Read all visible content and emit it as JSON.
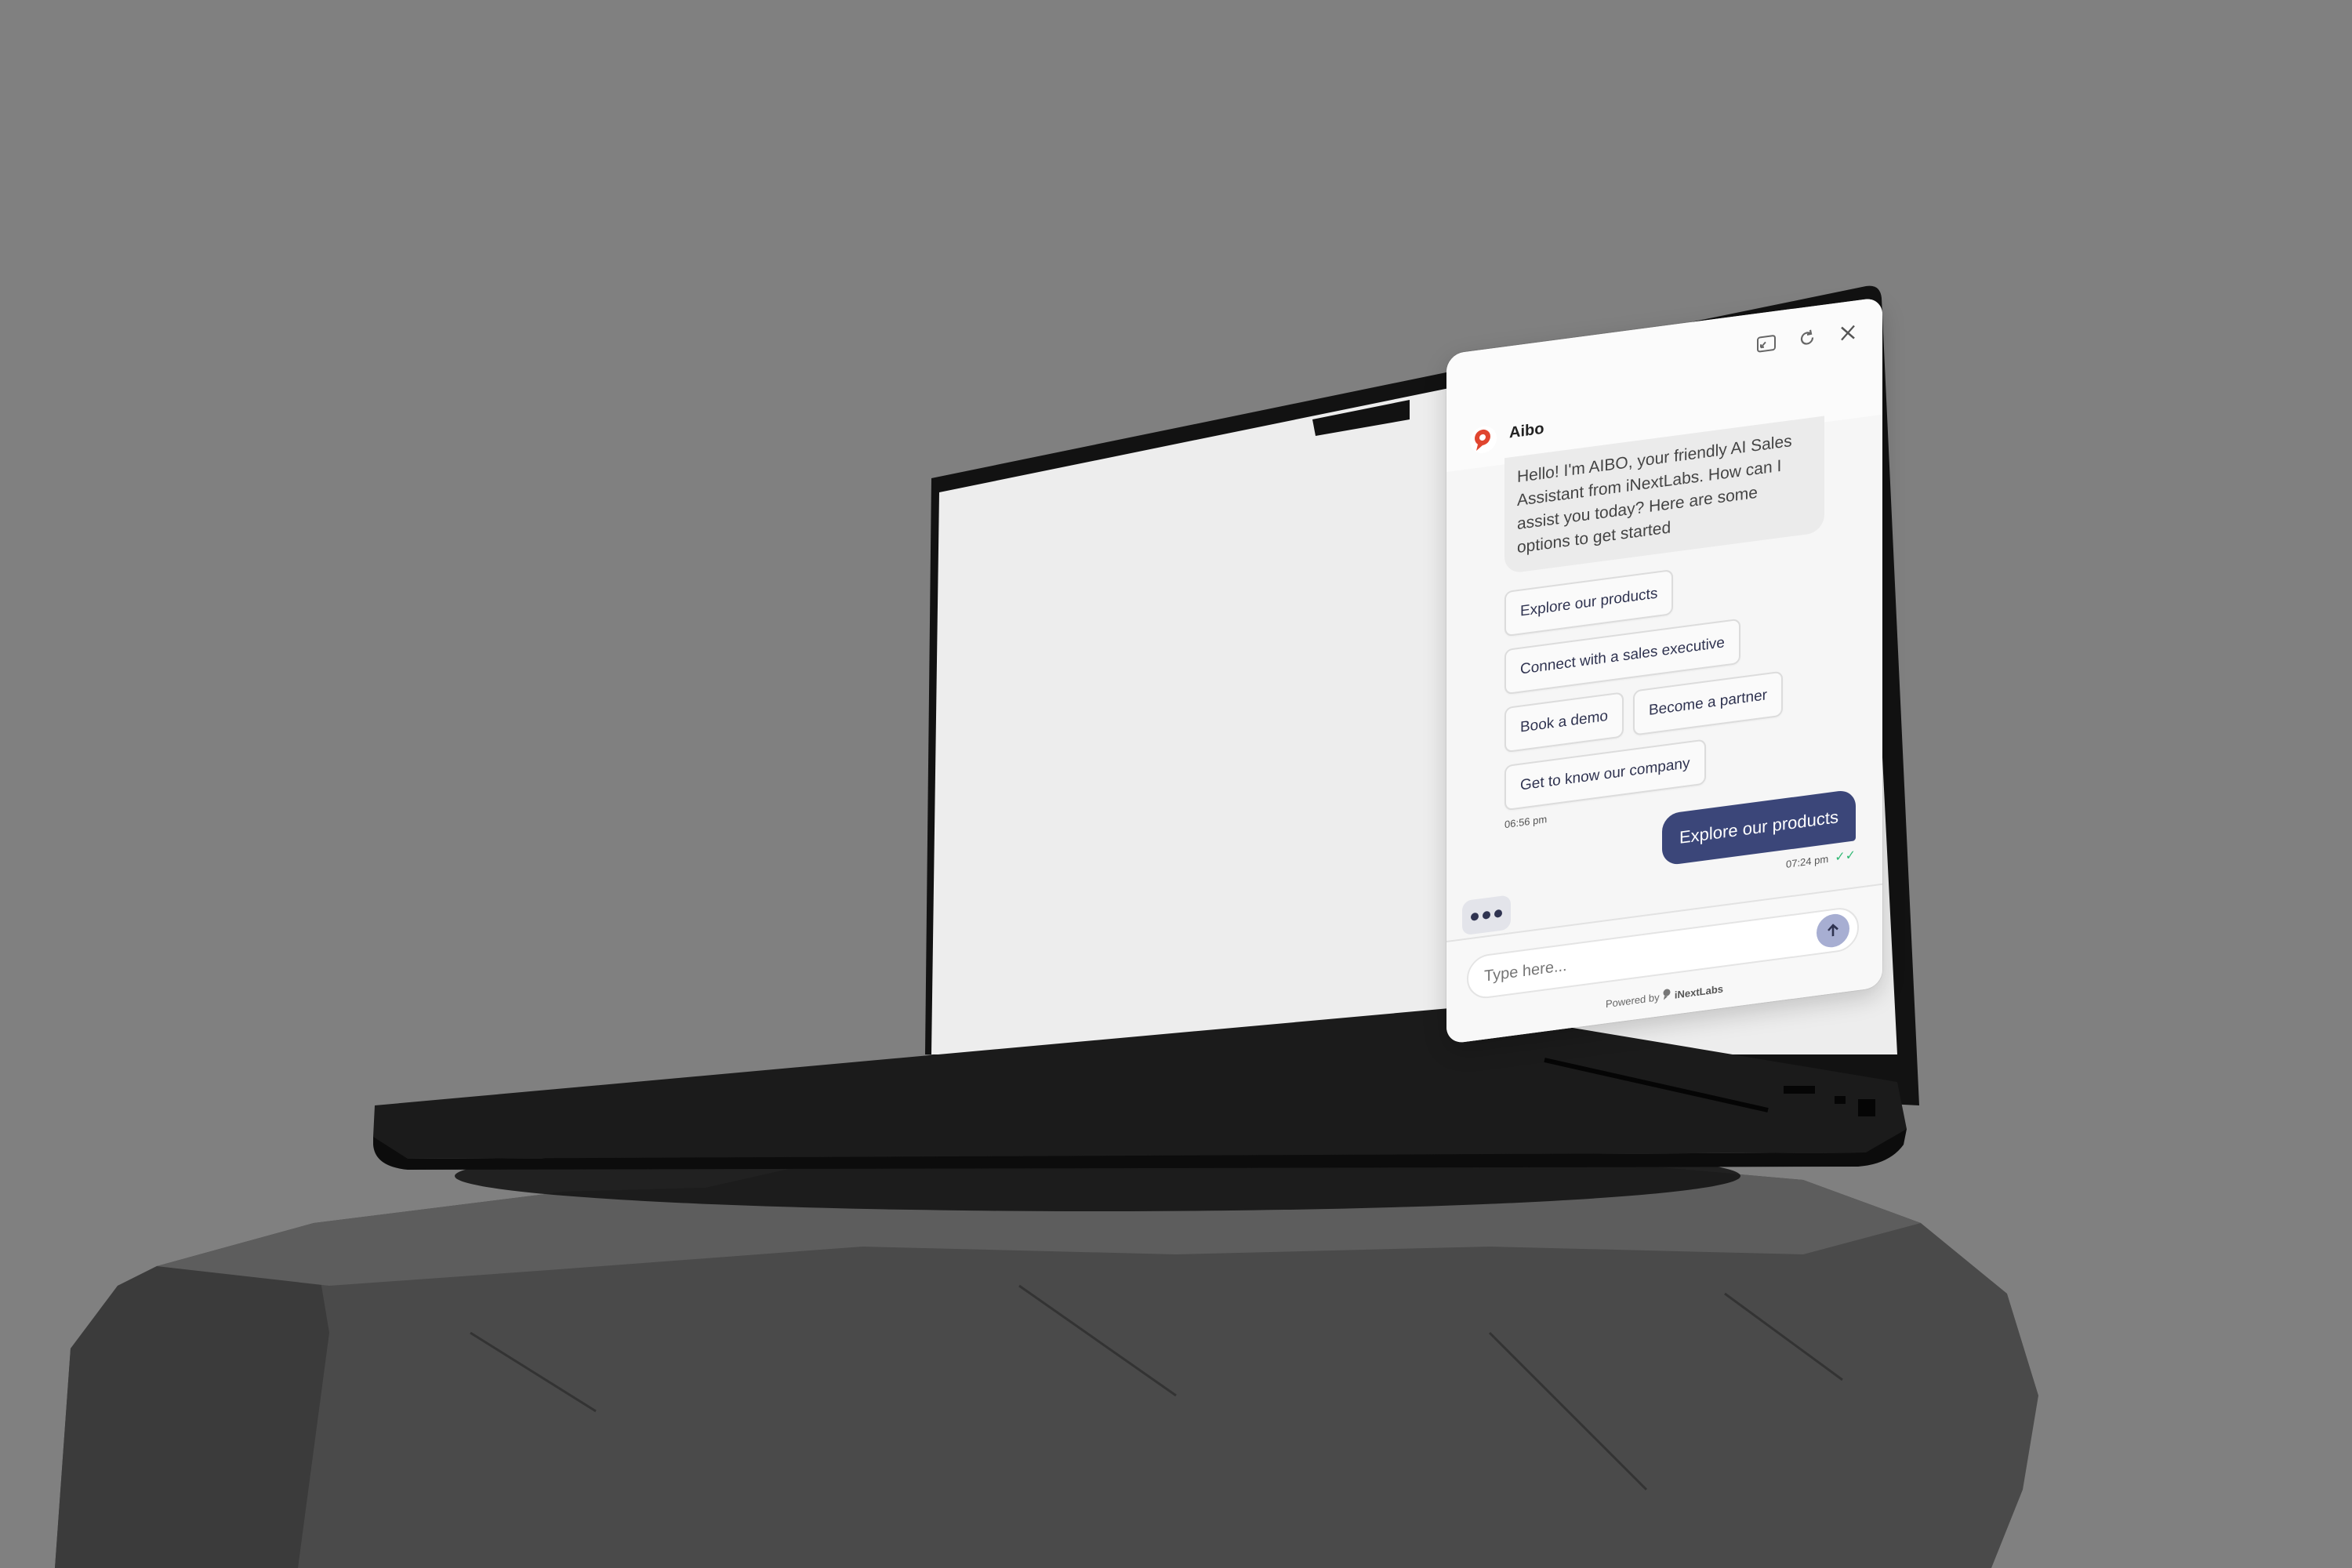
{
  "chat": {
    "bot_name": "Aibo",
    "header_icons": [
      "expand-icon",
      "refresh-icon",
      "close-icon"
    ],
    "greeting": "Hello! I'm AIBO, your friendly AI Sales Assistant from iNextLabs. How can I assist you today? Here are some options to get started",
    "options": [
      "Explore our products",
      "Connect with a sales executive",
      "Book a demo",
      "Become a partner",
      "Get to know our company"
    ],
    "bot_time": "06:56 pm",
    "user_message": "Explore our products",
    "user_time": "07:24 pm",
    "input_placeholder": "Type here...",
    "powered_by": "Powered by",
    "brand": "iNextLabs"
  },
  "colors": {
    "background": "#808080",
    "user_bubble": "#3b4679",
    "send_button": "#a7aed2",
    "read_check": "#2eb872",
    "logo_red": "#e0452f"
  }
}
